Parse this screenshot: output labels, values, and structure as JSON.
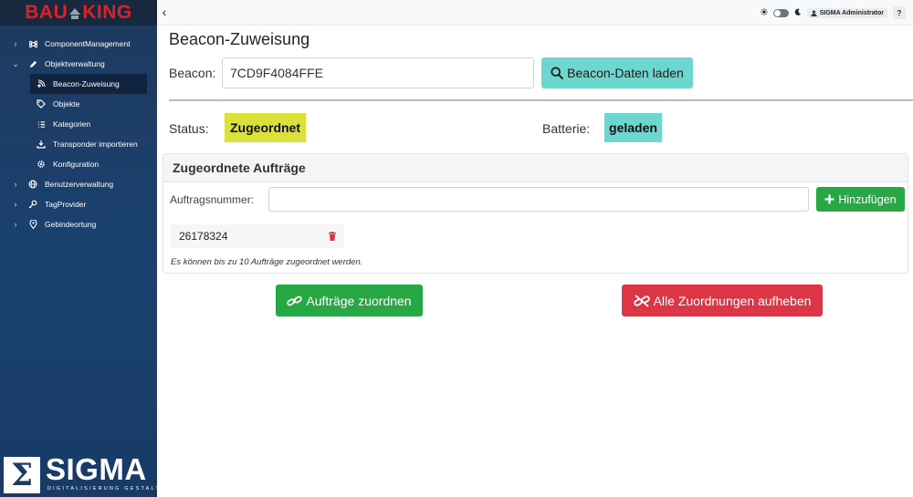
{
  "brand": {
    "left": "BAU",
    "right": "KING",
    "color": "#e11f26"
  },
  "sidebar": {
    "items": [
      {
        "label": "ComponentManagement",
        "icon": "command-icon",
        "chevron": "›",
        "level": 0
      },
      {
        "label": "Objektverwaltung",
        "icon": "pencil-icon",
        "chevron": "⌄",
        "level": 0
      },
      {
        "label": "Beacon-Zuweisung",
        "icon": "beacon-icon",
        "level": 1,
        "active": true
      },
      {
        "label": "Objekte",
        "icon": "tag-icon",
        "level": 1
      },
      {
        "label": "Kategorien",
        "icon": "list-icon",
        "level": 1
      },
      {
        "label": "Transponder importieren",
        "icon": "import-icon",
        "level": 1
      },
      {
        "label": "Konfiguration",
        "icon": "gear-icon",
        "level": 1
      },
      {
        "label": "Benutzerverwaltung",
        "icon": "globe-icon",
        "chevron": "›",
        "level": 0
      },
      {
        "label": "TagProvider",
        "icon": "key-icon",
        "chevron": "›",
        "level": 0
      },
      {
        "label": "Gebindeortung",
        "icon": "location-pin-icon",
        "chevron": "›",
        "level": 0
      }
    ],
    "footer_logo": {
      "symbol": "Σ",
      "word": "SIGMA",
      "tagline": "DIGITALISIERUNG GESTALTEN"
    }
  },
  "topbar": {
    "collapse": "‹",
    "user": "SIGMA Administrator",
    "help": "?"
  },
  "main": {
    "title": "Beacon-Zuweisung",
    "beacon_label": "Beacon:",
    "beacon_value": "7CD9F4084FFE",
    "load_button": "Beacon-Daten laden",
    "status_label": "Status:",
    "status_value": "Zugeordnet",
    "battery_label": "Batterie:",
    "battery_value": "geladen",
    "orders_card": {
      "title": "Zugeordnete Aufträge",
      "order_label": "Auftragsnummer:",
      "order_value": "",
      "add_button": "Hinzufügen",
      "orders": [
        "26178324"
      ],
      "hint": "Es können bis zu 10 Aufträge zugeordnet werden."
    },
    "assign_button": "Aufträge zuordnen",
    "clear_button": "Alle Zuordnungen aufheben"
  },
  "colors": {
    "sidebar": "#1d3a5f",
    "info": "#6dd7cf",
    "status_badge": "#dce03a",
    "success": "#28a745",
    "danger": "#dc3545"
  }
}
